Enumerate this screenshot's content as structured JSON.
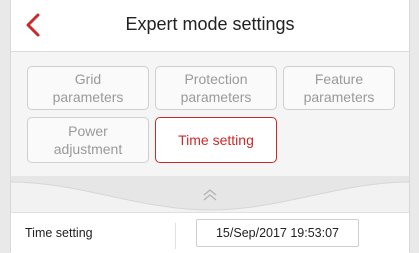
{
  "header": {
    "title": "Expert mode settings",
    "back_icon": "chevron-left-icon",
    "accent": "#cc2a2a"
  },
  "tabs": [
    {
      "line1": "Grid",
      "line2": "parameters",
      "selected": false
    },
    {
      "line1": "Protection",
      "line2": "parameters",
      "selected": false
    },
    {
      "line1": "Feature",
      "line2": "parameters",
      "selected": false
    },
    {
      "line1": "Power",
      "line2": "adjustment",
      "selected": false
    },
    {
      "label": "Time setting",
      "selected": true
    }
  ],
  "collapse": {
    "icon": "double-chevron-up-icon"
  },
  "time_row": {
    "label": "Time setting",
    "value": "15/Sep/2017 19:53:07"
  }
}
